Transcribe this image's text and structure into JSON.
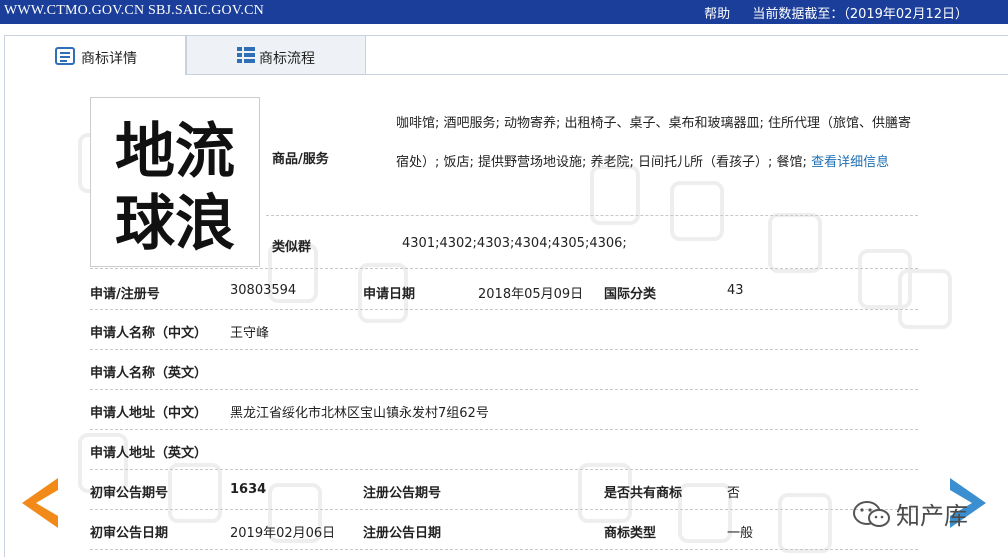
{
  "header": {
    "site_links": "WWW.CTMO.GOV.CN SBJ.SAIC.GOV.CN",
    "help": "帮助",
    "data_date": "当前数据截至：（2019年02月12日）"
  },
  "tabs": [
    {
      "label": "商标详情",
      "icon": "document-icon",
      "active": true
    },
    {
      "label": "商标流程",
      "icon": "list-icon",
      "active": false
    }
  ],
  "trademark": {
    "logo_text": [
      "地流",
      "球浪"
    ],
    "goods_services_label": "商品/服务",
    "goods_services_text": "咖啡馆; 酒吧服务; 动物寄养; 出租椅子、桌子、桌布和玻璃器皿; 住所代理（旅馆、供膳寄宿处）; 饭店; 提供野营场地设施; 养老院; 日间托儿所（看孩子）; 餐馆;",
    "view_details": "查看详细信息",
    "similar_group_label": "类似群",
    "similar_group_value": "4301;4302;4303;4304;4305;4306;"
  },
  "rows": {
    "reg_no_label": "申请/注册号",
    "reg_no": "30803594",
    "apply_date_label": "申请日期",
    "apply_date": "2018年05月09日",
    "intl_class_label": "国际分类",
    "intl_class": "43",
    "applicant_cn_label": "申请人名称（中文）",
    "applicant_cn": "王守峰",
    "applicant_en_label": "申请人名称（英文）",
    "applicant_en": "",
    "address_cn_label": "申请人地址（中文）",
    "address_cn": "黑龙江省绥化市北林区宝山镇永发村7组62号",
    "address_en_label": "申请人地址（英文）",
    "address_en": "",
    "prelim_pub_no_label": "初审公告期号",
    "prelim_pub_no": "1634",
    "reg_pub_no_label": "注册公告期号",
    "reg_pub_no": "",
    "shared_label": "是否共有商标",
    "shared": "否",
    "prelim_pub_date_label": "初审公告日期",
    "prelim_pub_date": "2019年02月06日",
    "reg_pub_date_label": "注册公告日期",
    "reg_pub_date": "",
    "type_label": "商标类型",
    "type": "一般"
  },
  "watermark": {
    "text": "中国商标",
    "brand": "知产库"
  },
  "colors": {
    "topbar": "#1a3e99",
    "link": "#1f6fb4",
    "prev_arrow": "#f28a1a",
    "next_arrow": "#3b8fd0"
  }
}
